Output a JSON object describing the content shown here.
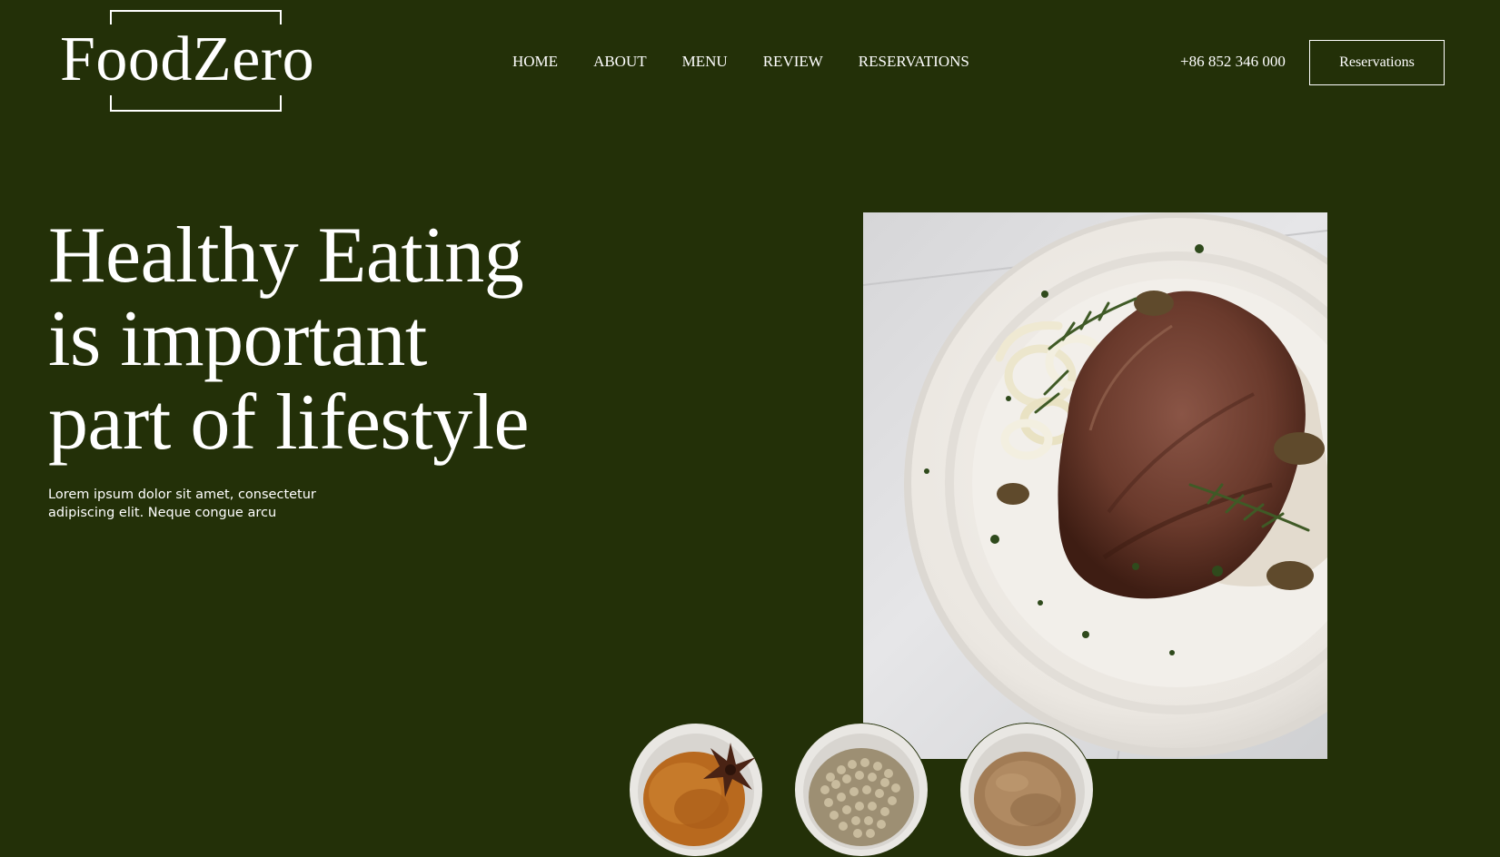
{
  "brand": {
    "name": "FoodZero"
  },
  "nav": {
    "items": [
      {
        "label": "HOME"
      },
      {
        "label": "ABOUT"
      },
      {
        "label": "MENU"
      },
      {
        "label": "REVIEW"
      },
      {
        "label": "RESERVATIONS"
      }
    ]
  },
  "header": {
    "phone": "+86 852 346 000",
    "reserve_label": "Reservations"
  },
  "hero": {
    "title_lines": [
      "Healthy Eating",
      "is important",
      "part of lifestyle"
    ],
    "description": "Lorem ipsum dolor sit amet, consectetur adipiscing elit. Neque congue arcu"
  },
  "images": {
    "hero": "steak-plate-photo",
    "spices": [
      "cinnamon-star-anise-bowl",
      "peppercorn-bowl",
      "ground-spice-bowl"
    ]
  },
  "colors": {
    "background": "#233008",
    "text": "#ffffff"
  }
}
